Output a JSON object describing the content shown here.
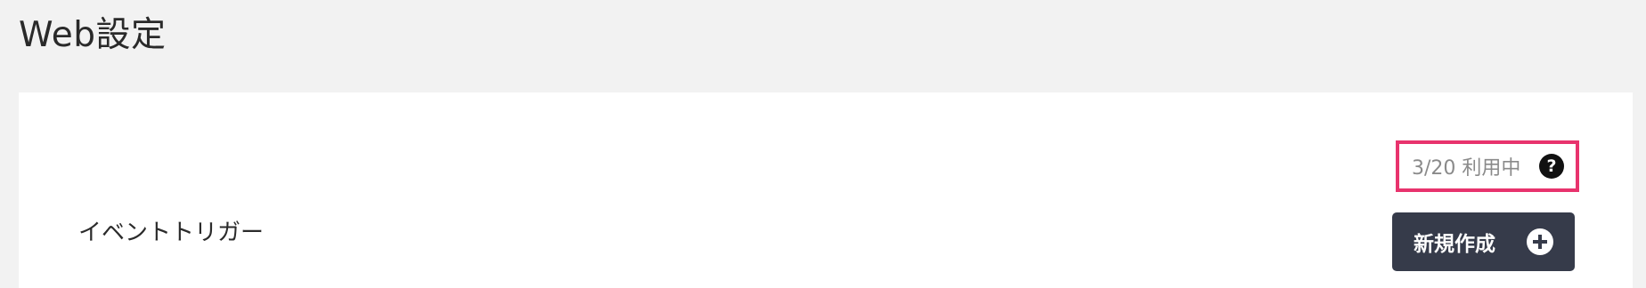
{
  "page": {
    "title": "Web設定"
  },
  "usage": {
    "text": "3/20 利用中",
    "help_icon": "question-circle-icon",
    "help_glyph": "?",
    "highlight_color": "#e8336d"
  },
  "event_trigger": {
    "label": "イベントトリガー",
    "create_button_label": "新規作成",
    "create_button_icon": "plus-circle-icon",
    "button_color": "#363b4a"
  }
}
